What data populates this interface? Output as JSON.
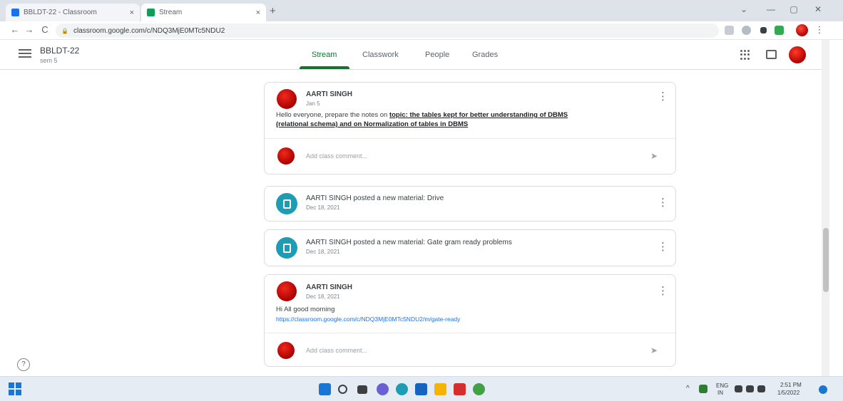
{
  "browser": {
    "tabs": [
      {
        "title": "BBLDT-22 - Classroom",
        "close": "×"
      },
      {
        "title": "Stream",
        "close": "×"
      }
    ],
    "new_tab": "+",
    "window_controls": {
      "menu": "⌄",
      "minimize": "—",
      "maximize": "▢",
      "close": "✕"
    },
    "nav": {
      "back": "←",
      "forward": "→",
      "reload": "C",
      "lock": "🔒"
    },
    "url": "classroom.google.com/c/NDQ3MjE0MTc5NDU2",
    "colors": {
      "tab_strip": "#dee3ea",
      "favicon_1": "#1a73e8",
      "favicon_2": "#0f9d58"
    }
  },
  "classroom": {
    "class_title": "BBLDT-22",
    "class_subtitle": "sem 5",
    "tabs": [
      "Stream",
      "Classwork",
      "People",
      "Grades"
    ],
    "active_tab": "Stream",
    "accent": "#137333"
  },
  "posts": [
    {
      "author": "AARTI SINGH",
      "date": "Jan 5",
      "body_plain": "Hello everyone, prepare the notes on ",
      "body_bold_1": "topic: the tables kept for better understanding of DBMS",
      "body_bold_2": "(relational schema) and on Normalization of tables in DBMS",
      "comment_placeholder": "Add class comment...",
      "send": "➤"
    },
    {
      "text": "AARTI SINGH posted a new material: Drive",
      "date": "Dec 18, 2021"
    },
    {
      "text": "AARTI SINGH posted a new material: Gate gram ready problems",
      "date": "Dec 18, 2021"
    },
    {
      "author": "AARTI SINGH",
      "date": "Dec 18, 2021",
      "body": "Hi All good morning",
      "link": "https://classroom.google.com/c/NDQ3MjE0MTc5NDU2/m/gate-ready",
      "comment_placeholder": "Add class comment...",
      "send": "➤"
    }
  ],
  "more_icon": "⋮",
  "help": "?",
  "taskbar": {
    "tray_chevron": "^",
    "language": "ENG",
    "region": "IN",
    "time": "2:51 PM",
    "date": "1/5/2022"
  }
}
